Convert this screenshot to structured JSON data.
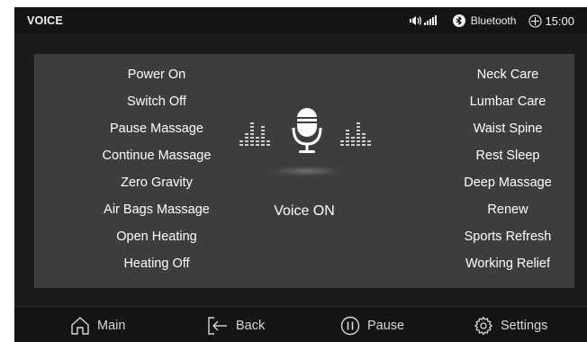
{
  "status_bar": {
    "title": "VOICE",
    "bluetooth_label": "Bluetooth",
    "time": "15:00"
  },
  "commands_left": [
    "Power On",
    "Switch Off",
    "Pause Massage",
    "Continue Massage",
    "Zero Gravity",
    "Air  Bags Massage",
    "Open Heating",
    "Heating Off"
  ],
  "commands_right": [
    "Neck Care",
    "Lumbar Care",
    "Waist Spine",
    "Rest Sleep",
    "Deep Massage",
    "Renew",
    "Sports Refresh",
    "Working Relief"
  ],
  "voice": {
    "status": "Voice ON"
  },
  "nav": {
    "main_label": "Main",
    "back_label": "Back",
    "pause_label": "Pause",
    "settings_label": "Settings"
  },
  "icons": [
    "volume-icon",
    "signal-icon",
    "bluetooth-icon",
    "clock-icon",
    "microphone-icon",
    "equalizer-icon",
    "home-icon",
    "back-icon",
    "pause-icon",
    "settings-icon"
  ],
  "colors": {
    "background": "#1b1b1c",
    "panel": "#3b3d3f",
    "text": "#ffffff",
    "bar": "#141415"
  }
}
